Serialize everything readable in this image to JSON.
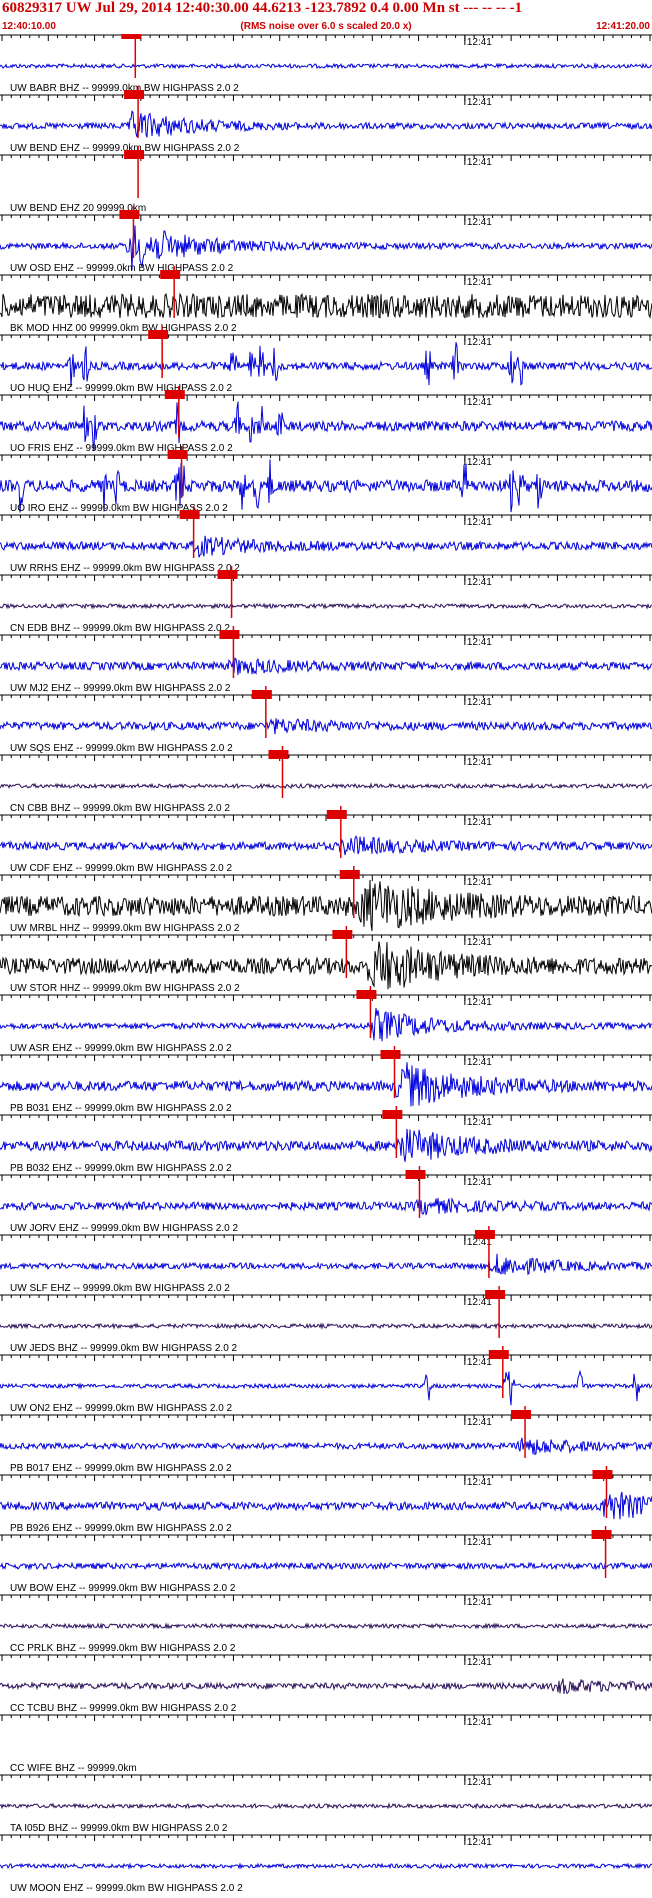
{
  "header": {
    "title": "60829317 UW Jul 29, 2014 12:40:30.00   44.6213 -123.7892  0.4 0.00 Mn st --- -- --  -1",
    "time_left": "12:40:10.00",
    "time_right": "12:41:20.00",
    "subtitle": "(RMS noise over 6.0 s scaled 20.0 x)"
  },
  "colors": {
    "header_text": "#cc0000",
    "pick": "#dd0000",
    "trace_blue": "#0000dd",
    "trace_black": "#000000",
    "trace_purple": "#2a0f5a",
    "axis": "#000000"
  },
  "time_window_s": [
    0,
    70
  ],
  "minute_marker": {
    "label": "12:41",
    "time_s": 50
  },
  "traces": [
    {
      "label": "UW BABR BHZ -- 99999.0km BW  HIGHPASS  2.0  2",
      "color": "blue",
      "pick_s": 14.4,
      "amp": 2
    },
    {
      "label": "UW BEND EHZ -- 99999.0km BW  HIGHPASS  2.0  2",
      "color": "blue",
      "pick_s": 14.7,
      "amp": 3,
      "event_s": 14,
      "event_amp": 14
    },
    {
      "label": "UW BEND EHZ 20 99999.0km",
      "color": "blue",
      "pick_s": 14.7,
      "amp": 0
    },
    {
      "label": "UW OSD EHZ -- 99999.0km BW  HIGHPASS  2.0  2",
      "color": "blue",
      "pick_s": 14.2,
      "amp": 3,
      "event_s": 14,
      "event_amp": 22
    },
    {
      "label": "BK MOD HHZ 00 99999.0km BW  HIGHPASS  2.0  2",
      "color": "black",
      "pick_s": 18.6,
      "amp": 12
    },
    {
      "label": "UO HUQ EHZ -- 99999.0km BW  HIGHPASS  2.0  2",
      "color": "blue",
      "pick_s": 17.3,
      "amp": 4,
      "bursts_s": [
        7.5,
        9,
        25,
        27,
        28,
        29.5,
        46,
        49,
        55,
        56
      ]
    },
    {
      "label": "UO FRIS EHZ -- 99999.0km BW  HIGHPASS  2.0  2",
      "color": "blue",
      "pick_s": 19.1,
      "amp": 5,
      "bursts_s": [
        9,
        10,
        19,
        25.5,
        27,
        28,
        30
      ]
    },
    {
      "label": "UO IRO EHZ -- 99999.0km BW  HIGHPASS  2.0  2",
      "color": "blue",
      "pick_s": 19.4,
      "amp": 6,
      "bursts_s": [
        2,
        11,
        12.5,
        19,
        19.5,
        26,
        27.5,
        29,
        50,
        55,
        56,
        58
      ]
    },
    {
      "label": "UW RRHS EHZ -- 99999.0km BW  HIGHPASS  2.0  2",
      "color": "blue",
      "pick_s": 20.7,
      "amp": 4,
      "event_s": 21,
      "event_amp": 8
    },
    {
      "label": "CN EDB BHZ -- 99999.0km BW  HIGHPASS  2.0  2",
      "color": "purple",
      "pick_s": 24.8,
      "amp": 2
    },
    {
      "label": "UW MJ2 EHZ -- 99999.0km BW  HIGHPASS  2.0  2",
      "color": "blue",
      "pick_s": 25.0,
      "amp": 4,
      "event_s": 25,
      "event_amp": 6
    },
    {
      "label": "UW SQS EHZ -- 99999.0km BW  HIGHPASS  2.0  2",
      "color": "blue",
      "pick_s": 28.5,
      "amp": 4,
      "event_s": 29,
      "event_amp": 5
    },
    {
      "label": "CN CBB BHZ -- 99999.0km BW  HIGHPASS  2.0  2",
      "color": "purple",
      "pick_s": 30.3,
      "amp": 2
    },
    {
      "label": "UW CDF EHZ -- 99999.0km BW  HIGHPASS  2.0  2",
      "color": "blue",
      "pick_s": 36.6,
      "amp": 4,
      "event_s": 37,
      "event_amp": 8
    },
    {
      "label": "UW MRBL HHZ -- 99999.0km BW  HIGHPASS  2.0  2",
      "color": "black",
      "pick_s": 38.0,
      "amp": 10,
      "event_s": 39,
      "event_amp": 25
    },
    {
      "label": "UW STOR HHZ -- 99999.0km BW  HIGHPASS  2.0  2",
      "color": "black",
      "pick_s": 37.2,
      "amp": 8,
      "event_s": 40,
      "event_amp": 24
    },
    {
      "label": "UW ASR EHZ -- 99999.0km BW  HIGHPASS  2.0  2",
      "color": "blue",
      "pick_s": 39.8,
      "amp": 3,
      "event_s": 40,
      "event_amp": 16
    },
    {
      "label": "PB B031 EHZ -- 99999.0km BW  HIGHPASS  2.0  2",
      "color": "blue",
      "pick_s": 42.4,
      "amp": 5,
      "event_s": 43,
      "event_amp": 22
    },
    {
      "label": "PB B032 EHZ -- 99999.0km BW  HIGHPASS  2.0  2",
      "color": "blue",
      "pick_s": 42.6,
      "amp": 5,
      "event_s": 43,
      "event_amp": 16
    },
    {
      "label": "UW JORV EHZ -- 99999.0km BW  HIGHPASS  2.0  2",
      "color": "blue",
      "pick_s": 45.1,
      "amp": 4,
      "event_s": 45,
      "event_amp": 6
    },
    {
      "label": "UW SLF EHZ -- 99999.0km BW  HIGHPASS  2.0  2",
      "color": "blue",
      "pick_s": 52.6,
      "amp": 3,
      "event_s": 53,
      "event_amp": 10
    },
    {
      "label": "UW JEDS BHZ -- 99999.0km BW  HIGHPASS  2.0  2",
      "color": "purple",
      "pick_s": 53.7,
      "amp": 2
    },
    {
      "label": "UW ON2 EHZ -- 99999.0km BW  HIGHPASS  2.0  2",
      "color": "blue",
      "pick_s": 54.1,
      "amp": 2,
      "bursts_s": [
        46,
        54.5,
        55,
        62.5,
        68.5
      ]
    },
    {
      "label": "PB B017 EHZ -- 99999.0km BW  HIGHPASS  2.0  2",
      "color": "blue",
      "pick_s": 56.5,
      "amp": 3,
      "event_s": 56,
      "event_amp": 8
    },
    {
      "label": "PB B926 EHZ -- 99999.0km BW  HIGHPASS  2.0  2",
      "color": "blue",
      "pick_s": 65.3,
      "amp": 4,
      "event_s": 65,
      "event_amp": 14
    },
    {
      "label": "UW BOW EHZ -- 99999.0km BW  HIGHPASS  2.0  2",
      "color": "blue",
      "pick_s": 65.2,
      "amp": 3
    },
    {
      "label": "CC PRLK BHZ -- 99999.0km BW  HIGHPASS  2.0  2",
      "color": "purple",
      "amp": 2
    },
    {
      "label": "CC TCBU BHZ -- 99999.0km BW  HIGHPASS  2.0  2",
      "color": "purple",
      "amp": 3,
      "event_s": 60,
      "event_amp": 6
    },
    {
      "label": "CC WIFE BHZ -- 99999.0km",
      "color": "purple",
      "amp": 0
    },
    {
      "label": "TA I05D BHZ -- 99999.0km BW  HIGHPASS  2.0  2",
      "color": "purple",
      "amp": 2
    },
    {
      "label": "UW MOON EHZ -- 99999.0km BW  HIGHPASS  2.0  2",
      "color": "blue",
      "amp": 2
    }
  ]
}
